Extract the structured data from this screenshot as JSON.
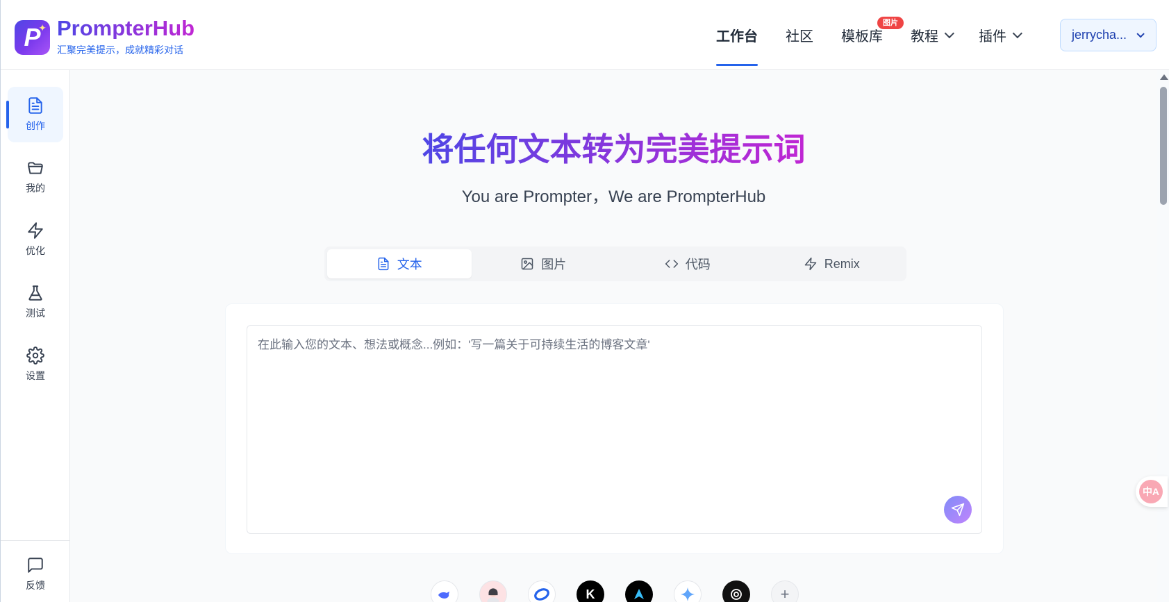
{
  "brand": {
    "logo_letter": "P",
    "title": "PrompterHub",
    "subtitle": "汇聚完美提示，成就精彩对话"
  },
  "nav": {
    "items": [
      {
        "label": "工作台",
        "active": true
      },
      {
        "label": "社区"
      },
      {
        "label": "模板库",
        "badge": "图片"
      },
      {
        "label": "教程",
        "dropdown": true
      },
      {
        "label": "插件",
        "dropdown": true
      }
    ],
    "user": "jerrycha..."
  },
  "sidebar": {
    "items": [
      {
        "label": "创作",
        "icon": "document-icon",
        "active": true
      },
      {
        "label": "我的",
        "icon": "folder-icon"
      },
      {
        "label": "优化",
        "icon": "lightning-icon"
      },
      {
        "label": "测试",
        "icon": "flask-icon"
      },
      {
        "label": "设置",
        "icon": "gear-icon"
      }
    ],
    "feedback": "反馈"
  },
  "hero": {
    "title": "将任何文本转为完美提示词",
    "subtitle": "You are Prompter，We are PrompterHub"
  },
  "tabs": [
    {
      "label": "文本",
      "icon": "document-icon",
      "active": true
    },
    {
      "label": "图片",
      "icon": "image-icon"
    },
    {
      "label": "代码",
      "icon": "code-icon"
    },
    {
      "label": "Remix",
      "icon": "lightning-icon"
    }
  ],
  "input": {
    "placeholder": "在此输入您的文本、想法或概念...例如：'写一篇关于可持续生活的博客文章'",
    "value": ""
  },
  "models": [
    {
      "name": "deepseek-icon",
      "bg": "#ffffff",
      "fg": "#4d6bfe"
    },
    {
      "name": "avatar-icon",
      "bg": "#ffffff",
      "fg": "#6b7280"
    },
    {
      "name": "doubao-icon",
      "bg": "#ffffff",
      "fg": "#2563eb"
    },
    {
      "name": "kimi-icon",
      "bg": "#000000",
      "fg": "#ffffff",
      "glyph": "K"
    },
    {
      "name": "plane-icon",
      "bg": "#000000",
      "fg": "#38bdf8"
    },
    {
      "name": "gemini-icon",
      "bg": "#ffffff",
      "fg": "#60a5fa"
    },
    {
      "name": "openai-icon",
      "bg": "#111111",
      "fg": "#ffffff"
    },
    {
      "name": "add-icon",
      "bg": "#f3f4f6",
      "fg": "#6b7280",
      "glyph": "+"
    }
  ],
  "floating": {
    "translate": "中A"
  },
  "colors": {
    "accent": "#2563eb",
    "brand_start": "#4f46e5",
    "brand_end": "#c026d3",
    "badge": "#ef4444"
  }
}
